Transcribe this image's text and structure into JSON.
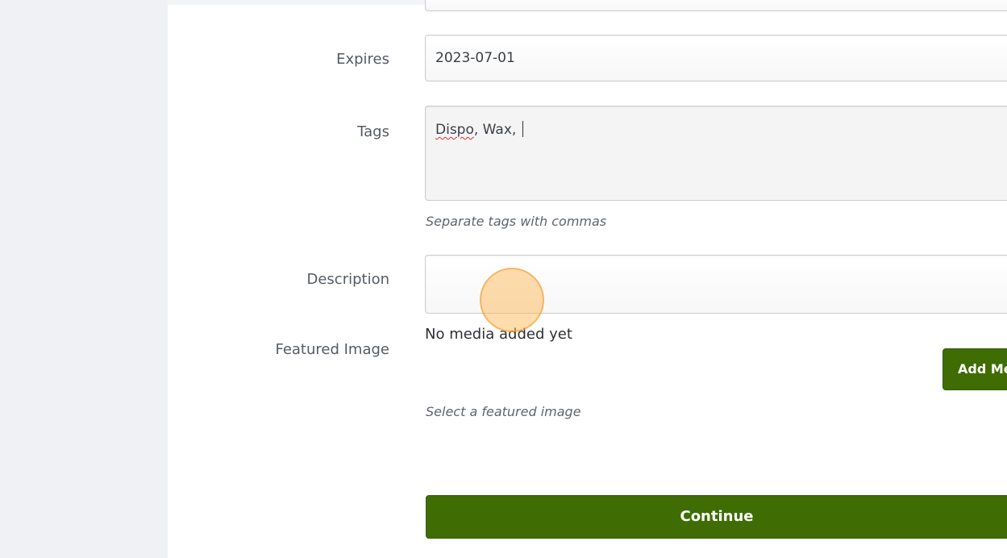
{
  "form": {
    "expires": {
      "label": "Expires",
      "value": "2023-07-01"
    },
    "tags": {
      "label": "Tags",
      "misspelled_word": "Dispo",
      "rest": ", Wax, ",
      "help": "Separate tags with commas"
    },
    "description": {
      "label": "Description",
      "value": ""
    },
    "featured_image": {
      "label": "Featured Image",
      "empty_text": "No media added yet",
      "add_button_label": "Add Me",
      "help": "Select a featured image"
    },
    "continue_label": "Continue"
  },
  "colors": {
    "button_green": "#3f6d04",
    "page_bg": "#f2f4f8",
    "panel_bg": "#ffffff",
    "click_indicator": "#ffb246"
  }
}
